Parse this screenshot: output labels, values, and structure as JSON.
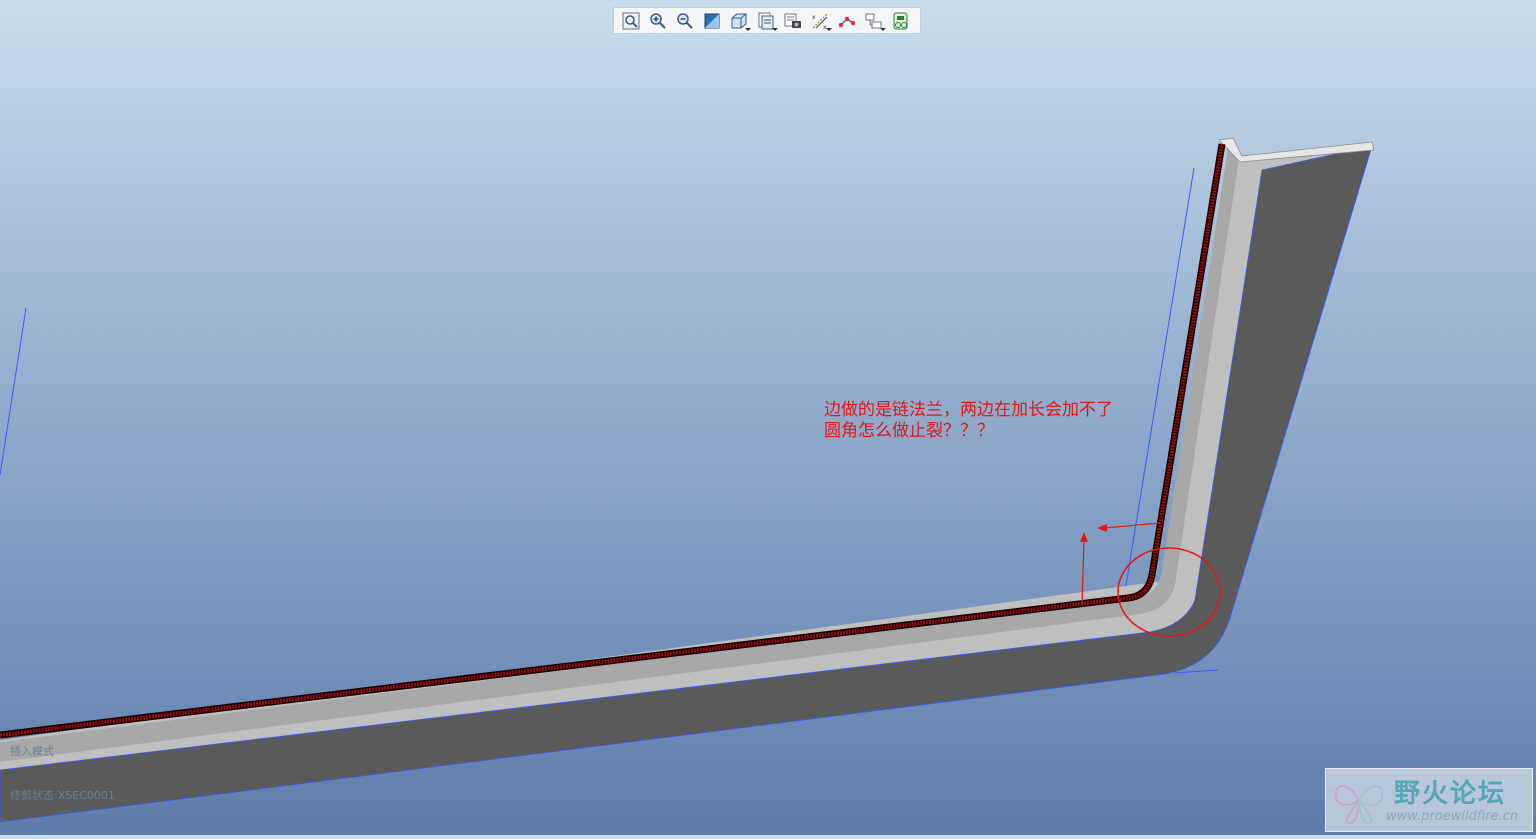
{
  "toolbar": {
    "buttons": [
      {
        "name": "zoom-fit-icon"
      },
      {
        "name": "zoom-in-icon"
      },
      {
        "name": "zoom-out-icon"
      },
      {
        "name": "repaint-icon"
      },
      {
        "name": "display-style-icon"
      },
      {
        "name": "saved-views-icon"
      },
      {
        "name": "view-manager-icon"
      },
      {
        "name": "datum-display-icon"
      },
      {
        "name": "annotation-display-icon"
      },
      {
        "name": "spin-center-icon"
      },
      {
        "name": "appearance-gallery-icon"
      }
    ]
  },
  "annotation": {
    "line1": "边做的是链法兰，两边在加长会加不了",
    "line2": "圆角怎么做止裂？？？",
    "color": "#e51616"
  },
  "status": {
    "insert_mode": "插入模式",
    "trim_status": "修剪状态:XSEC0001"
  },
  "watermark": {
    "title": "野火论坛",
    "url": "www.proewildfire.cn"
  },
  "colors": {
    "background_top": "#c8dcec",
    "background_bottom": "#5f7dab",
    "part_face": "#5a5a5a",
    "flange_edge": "#8b0f12",
    "datum_line": "#3b5bff"
  }
}
